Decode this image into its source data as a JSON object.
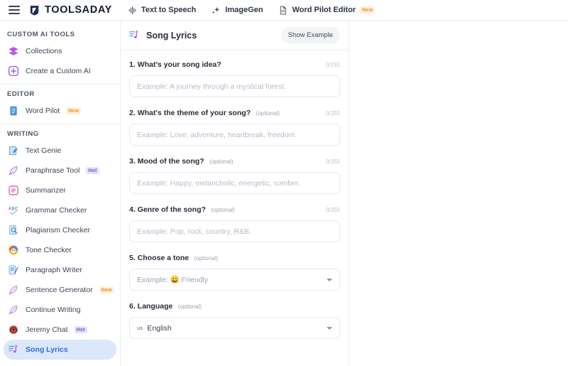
{
  "topbar": {
    "menu_icon": "hamburger-icon",
    "brand": "TOOLSADAY",
    "nav": [
      {
        "label": "Text to Speech",
        "icon": "waveform-icon",
        "badge": ""
      },
      {
        "label": "ImageGen",
        "icon": "sparkle-image-icon",
        "badge": ""
      },
      {
        "label": "Word Pilot Editor",
        "icon": "document-icon",
        "badge": "New"
      }
    ]
  },
  "sidebar": {
    "sections": [
      {
        "title": "CUSTOM AI TOOLS",
        "items": [
          {
            "label": "Collections",
            "icon": "layers-icon",
            "badge": "",
            "active": false
          },
          {
            "label": "Create a Custom AI",
            "icon": "plus-square-icon",
            "badge": "",
            "active": false
          }
        ]
      },
      {
        "title": "EDITOR",
        "items": [
          {
            "label": "Word Pilot",
            "icon": "document-blue-icon",
            "badge": "New",
            "active": false
          }
        ]
      },
      {
        "title": "WRITING",
        "items": [
          {
            "label": "Text Genie",
            "icon": "pencil-note-icon",
            "badge": "",
            "active": false
          },
          {
            "label": "Paraphrase Tool",
            "icon": "feather-icon",
            "badge": "Hot",
            "active": false
          },
          {
            "label": "Summarizer",
            "icon": "summary-icon",
            "badge": "",
            "active": false
          },
          {
            "label": "Grammar Checker",
            "icon": "abc-check-icon",
            "badge": "",
            "active": false
          },
          {
            "label": "Plagiarism Checker",
            "icon": "magnifier-doc-icon",
            "badge": "",
            "active": false
          },
          {
            "label": "Tone Checker",
            "icon": "smiley-color-icon",
            "badge": "",
            "active": false
          },
          {
            "label": "Paragraph Writer",
            "icon": "paragraph-icon",
            "badge": "",
            "active": false
          },
          {
            "label": "Sentence Generator",
            "icon": "quill-icon",
            "badge": "New",
            "active": false
          },
          {
            "label": "Continue Writing",
            "icon": "quill-blue-icon",
            "badge": "",
            "active": false
          },
          {
            "label": "Jeremy Chat",
            "icon": "avatar-icon",
            "badge": "Hot",
            "active": false
          },
          {
            "label": "Song Lyrics",
            "icon": "music-note-icon",
            "badge": "",
            "active": true
          }
        ]
      }
    ]
  },
  "panel": {
    "title": "Song Lyrics",
    "title_icon": "music-note-icon",
    "show_example_label": "Show Example",
    "fields": [
      {
        "label": "1. What's your song idea?",
        "optional": "",
        "counter": "0/255",
        "type": "text",
        "placeholder": "Example: A journey through a mystical forest.",
        "value": ""
      },
      {
        "label": "2. What's the theme of your song?",
        "optional": "(optional)",
        "counter": "0/255",
        "type": "text",
        "placeholder": "Example: Love, adventure, heartbreak, freedom.",
        "value": ""
      },
      {
        "label": "3. Mood of the song?",
        "optional": "(optional)",
        "counter": "0/255",
        "type": "text",
        "placeholder": "Example: Happy, melancholic, energetic, somber.",
        "value": ""
      },
      {
        "label": "4. Genre of the song?",
        "optional": "(optional)",
        "counter": "0/255",
        "type": "text",
        "placeholder": "Example: Pop, rock, country, R&B.",
        "value": ""
      },
      {
        "label": "5. Choose a tone",
        "optional": "(optional)",
        "counter": "",
        "type": "select",
        "selected": "Example: 😀 Friendly",
        "selected_prefix": "Example:",
        "selected_emoji": "😀",
        "selected_text": "Friendly"
      },
      {
        "label": "6. Language",
        "optional": "(optional)",
        "counter": "",
        "type": "select-lang",
        "flag": "us",
        "selected_text": "English"
      }
    ]
  },
  "colors": {
    "accent_blue": "#2f6bea",
    "active_pill": "#dbe7fb",
    "badge_new_text": "#f59323",
    "badge_new_bg": "#fdf0dc",
    "badge_hot_text": "#6a56d6",
    "badge_hot_bg": "#e6e2fb",
    "border": "#e9ecf1",
    "placeholder": "#b4bccb",
    "counter": "#b9c4d6"
  }
}
